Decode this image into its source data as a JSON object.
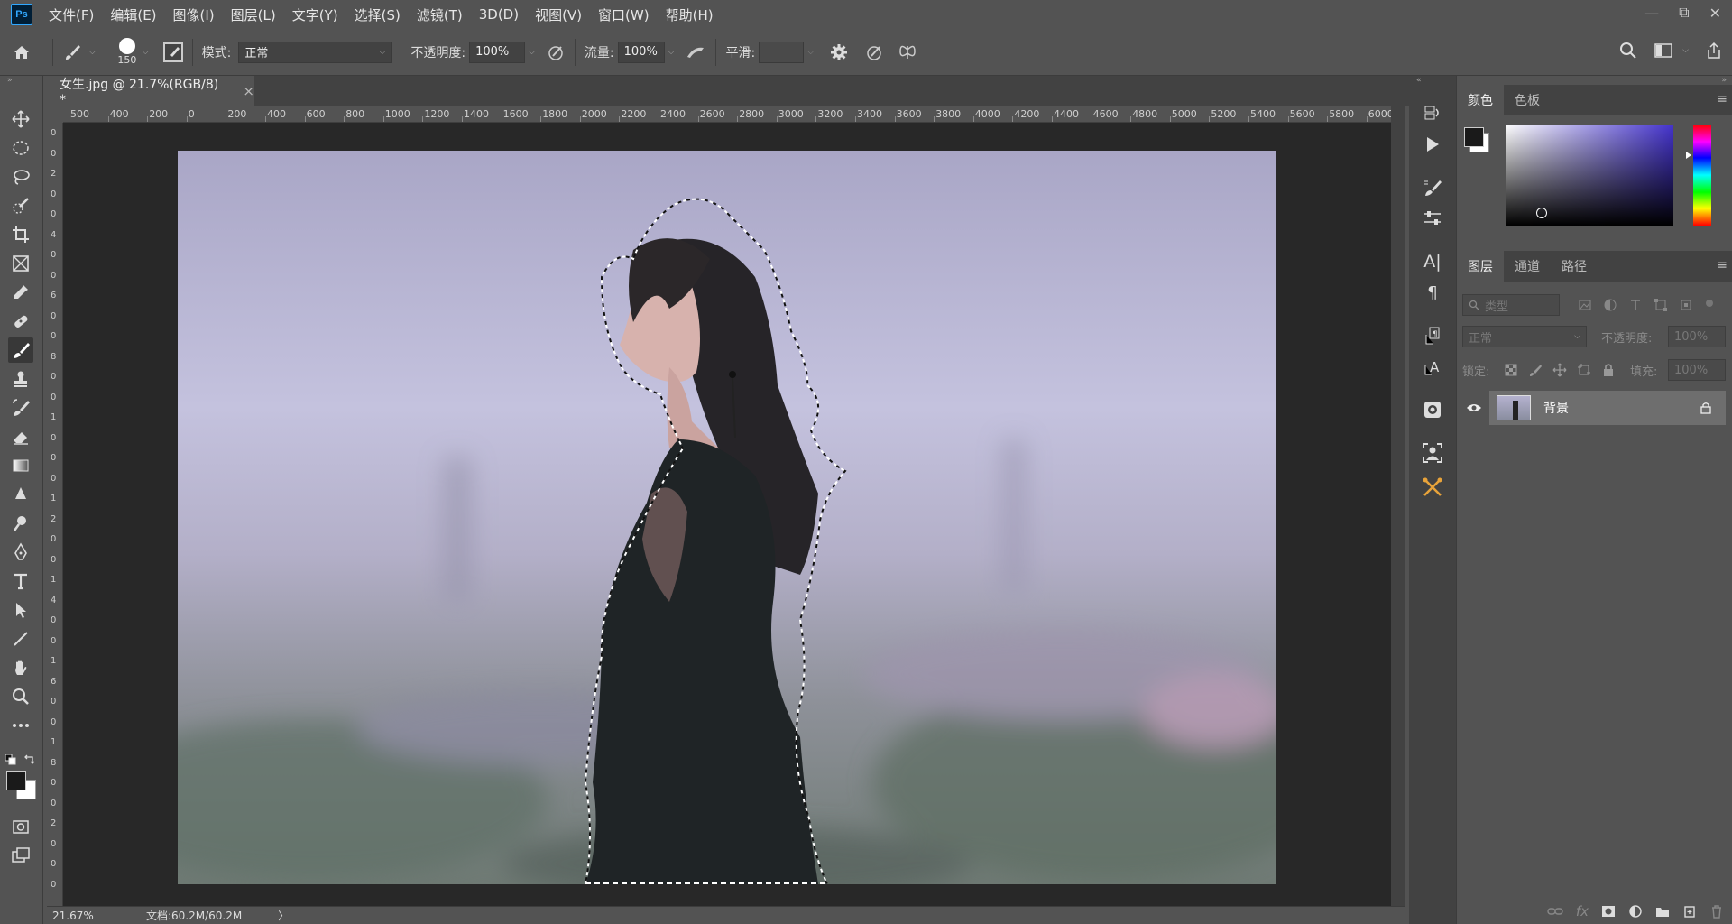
{
  "app": {
    "logo": "Ps"
  },
  "menu": [
    "文件(F)",
    "编辑(E)",
    "图像(I)",
    "图层(L)",
    "文字(Y)",
    "选择(S)",
    "滤镜(T)",
    "3D(D)",
    "视图(V)",
    "窗口(W)",
    "帮助(H)"
  ],
  "window_controls": {
    "minimize": "—",
    "restore": "⧉",
    "close": "✕"
  },
  "options": {
    "brush_size": "150",
    "mode_label": "模式:",
    "mode_value": "正常",
    "opacity_label": "不透明度:",
    "opacity_value": "100%",
    "flow_label": "流量:",
    "flow_value": "100%",
    "smooth_label": "平滑:",
    "smooth_value": ""
  },
  "document": {
    "tab_title": "女生.jpg @ 21.7%(RGB/8) *",
    "close": "×"
  },
  "ruler_h": [
    "500",
    "400",
    "200",
    "0",
    "200",
    "400",
    "600",
    "800",
    "1000",
    "1200",
    "1400",
    "1600",
    "1800",
    "2000",
    "2200",
    "2400",
    "2600",
    "2800",
    "3000",
    "3200",
    "3400",
    "3600",
    "3800",
    "4000",
    "4200",
    "4400",
    "4600",
    "4800",
    "5000",
    "5200",
    "5400",
    "5600",
    "5800",
    "6000"
  ],
  "ruler_v": [
    "0",
    "0",
    "2",
    "0",
    "0",
    "4",
    "0",
    "0",
    "6",
    "0",
    "0",
    "8",
    "0",
    "0",
    "1",
    "0",
    "0",
    "0",
    "1",
    "2",
    "0",
    "0",
    "1",
    "4",
    "0",
    "0",
    "1",
    "6",
    "0",
    "0",
    "1",
    "8",
    "0",
    "0",
    "2",
    "0",
    "0",
    "0"
  ],
  "status": {
    "zoom": "21.67%",
    "doc": "文档:60.2M/60.2M",
    "arrow": "〉"
  },
  "color_panel": {
    "tabs": [
      "颜色",
      "色板"
    ],
    "foreground": "#1a1a1a",
    "background": "#ffffff",
    "hue": "#4433cc"
  },
  "layers_panel": {
    "tabs": [
      "图层",
      "通道",
      "路径"
    ],
    "filter_label": "类型",
    "blend_mode": "正常",
    "opacity_label": "不透明度:",
    "opacity_value": "100%",
    "lock_label": "锁定:",
    "fill_label": "填充:",
    "fill_value": "100%",
    "layers": [
      {
        "name": "背景",
        "visible": true,
        "locked": true
      }
    ]
  },
  "colors": {
    "ui_bg": "#535353",
    "panel_dark": "#424242",
    "canvas_bg": "#282828",
    "accent": "#31a8ff"
  }
}
